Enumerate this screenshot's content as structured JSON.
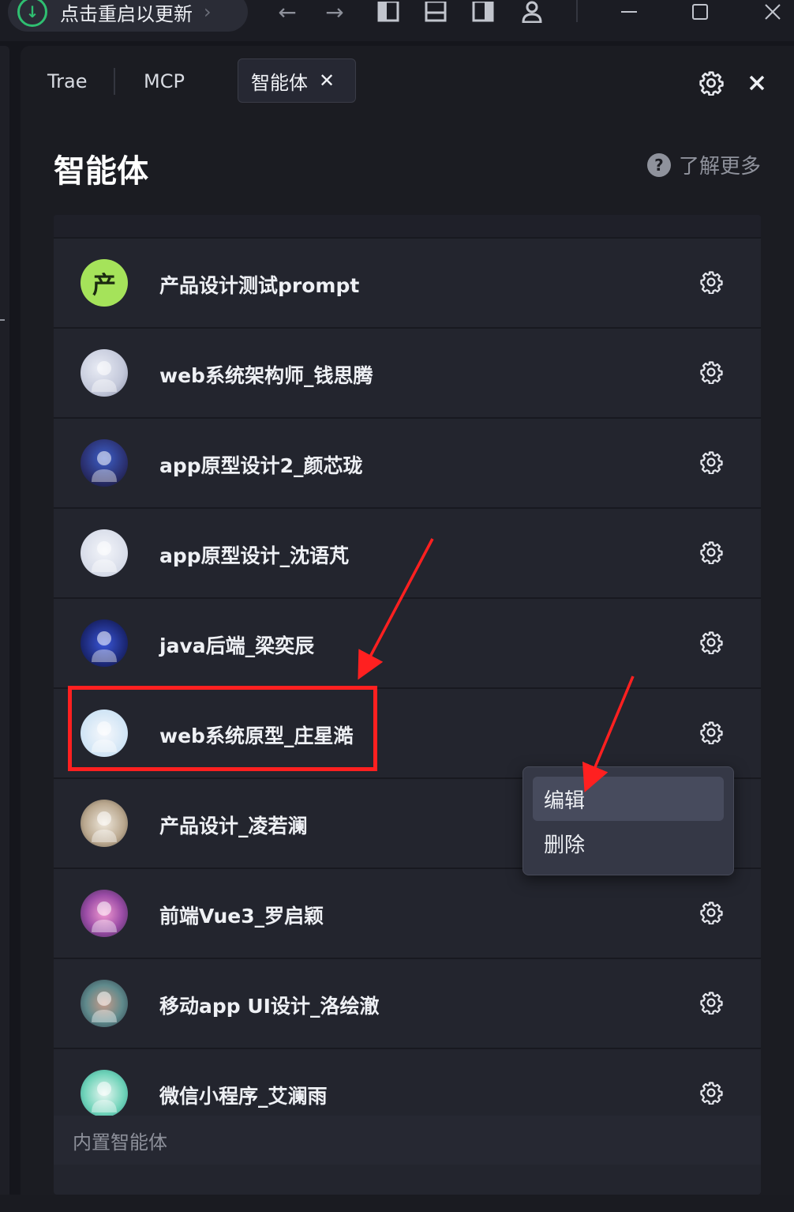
{
  "titlebar": {
    "update_label": "点击重启以更新",
    "back_icon": "arrow-left-icon",
    "forward_icon": "arrow-right-icon",
    "window_icons": [
      "layout-left-icon",
      "layout-bottom-icon",
      "layout-right-icon",
      "user-icon"
    ],
    "minimize_icon": "minimize-icon",
    "maximize_icon": "maximize-icon",
    "close_icon": "close-icon"
  },
  "tabs": [
    {
      "label": "Trae"
    },
    {
      "label": "MCP"
    },
    {
      "label": "智能体",
      "active": true,
      "close_glyph": "✕"
    }
  ],
  "header": {
    "title": "智能体",
    "learn_more": "了解更多",
    "help_glyph": "?"
  },
  "agents": [
    {
      "name": "产品设计测试prompt",
      "avatar_text": "产"
    },
    {
      "name": "web系统架构师_钱思腾"
    },
    {
      "name": "app原型设计2_颜芯珑"
    },
    {
      "name": "app原型设计_沈语芃"
    },
    {
      "name": "java后端_梁奕辰"
    },
    {
      "name": "web系统原型_庄星澔"
    },
    {
      "name": "产品设计_凌若澜"
    },
    {
      "name": "前端Vue3_罗启颖"
    },
    {
      "name": "移动app UI设计_洛绘澈"
    },
    {
      "name": "微信小程序_艾澜雨"
    }
  ],
  "builtin_label": "内置智能体",
  "context_menu": {
    "items": [
      "编辑",
      "删除"
    ]
  },
  "colors": {
    "accent_green": "#2fbf71",
    "annotation_red": "#ff2020",
    "avatar_green": "#a5e35a"
  }
}
